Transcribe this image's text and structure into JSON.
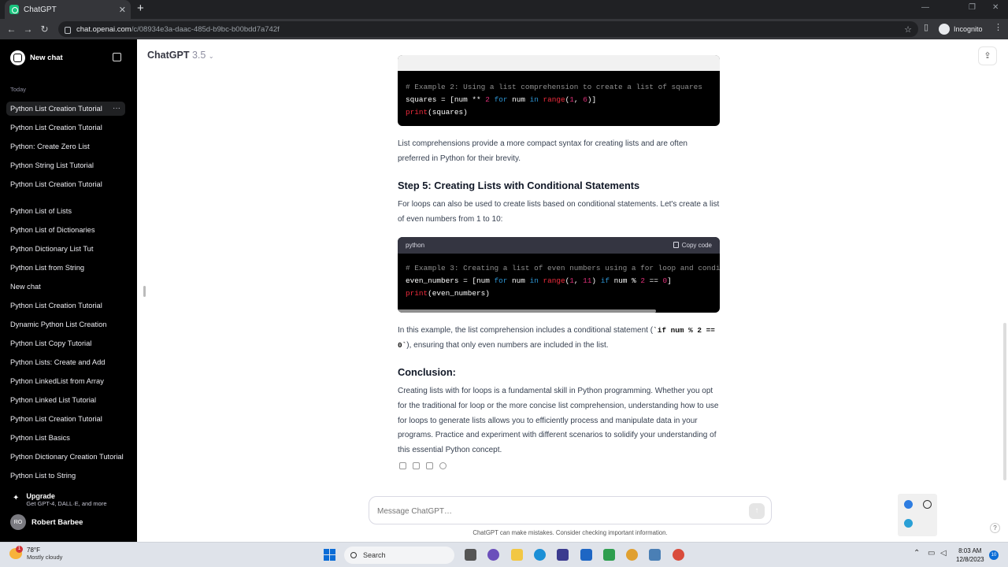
{
  "browser": {
    "tab_title": "ChatGPT",
    "url_host": "chat.openai.com",
    "url_path": "/c/08934e3a-daac-485d-b9bc-b00bdd7a742f",
    "profile_label": "Incognito"
  },
  "sidebar": {
    "new_chat_label": "New chat",
    "section_today": "Today",
    "items": [
      {
        "label": "Python List Creation Tutorial",
        "active": true
      },
      {
        "label": "Python List Creation Tutorial"
      },
      {
        "label": "Python: Create Zero List"
      },
      {
        "label": "Python String List Tutorial"
      },
      {
        "label": "Python List Creation Tutorial"
      },
      {
        "label": "Python List of Lists"
      },
      {
        "label": "Python List of Dictionaries"
      },
      {
        "label": "Python Dictionary List Tut"
      },
      {
        "label": "Python List from String"
      },
      {
        "label": "New chat"
      },
      {
        "label": "Python List Creation Tutorial"
      },
      {
        "label": "Dynamic Python List Creation"
      },
      {
        "label": "Python List Copy Tutorial"
      },
      {
        "label": "Python Lists: Create and Add"
      },
      {
        "label": "Python LinkedList from Array"
      },
      {
        "label": "Python Linked List Tutorial"
      },
      {
        "label": "Python List Creation Tutorial"
      },
      {
        "label": "Python List Basics"
      },
      {
        "label": "Python Dictionary Creation Tutorial"
      },
      {
        "label": "Python List to String"
      }
    ],
    "upgrade_title": "Upgrade",
    "upgrade_subtitle": "Get GPT-4, DALL·E, and more",
    "user_initials": "RO",
    "user_name": "Robert Barbee"
  },
  "main": {
    "model_name": "ChatGPT",
    "model_version": "3.5",
    "code1": {
      "lines": [
        [
          {
            "t": "# Example 2: Using a list comprehension to create a list of squares",
            "c": "cm"
          }
        ],
        [
          {
            "t": "squares = [num ** "
          },
          {
            "t": "2",
            "c": "nm"
          },
          {
            "t": " "
          },
          {
            "t": "for",
            "c": "kw"
          },
          {
            "t": " num "
          },
          {
            "t": "in",
            "c": "kw"
          },
          {
            "t": " "
          },
          {
            "t": "range",
            "c": "fn"
          },
          {
            "t": "("
          },
          {
            "t": "1",
            "c": "nm"
          },
          {
            "t": ", "
          },
          {
            "t": "6",
            "c": "nm"
          },
          {
            "t": ")]"
          }
        ],
        [
          {
            "t": "print",
            "c": "fn"
          },
          {
            "t": "(squares)"
          }
        ]
      ]
    },
    "para1": "List comprehensions provide a more compact syntax for creating lists and are often preferred in Python for their brevity.",
    "step5_heading": "Step 5: Creating Lists with Conditional Statements",
    "para2": "For loops can also be used to create lists based on conditional statements. Let's create a list of even numbers from 1 to 10:",
    "code2": {
      "language": "python",
      "copy_label": "Copy code",
      "lines": [
        [
          {
            "t": "# Example 3: Creating a list of even numbers using a for loop and condi",
            "c": "cm"
          }
        ],
        [
          {
            "t": "even_numbers = [num "
          },
          {
            "t": "for",
            "c": "kw"
          },
          {
            "t": " num "
          },
          {
            "t": "in",
            "c": "kw"
          },
          {
            "t": " "
          },
          {
            "t": "range",
            "c": "fn"
          },
          {
            "t": "("
          },
          {
            "t": "1",
            "c": "nm"
          },
          {
            "t": ", "
          },
          {
            "t": "11",
            "c": "nm"
          },
          {
            "t": ") "
          },
          {
            "t": "if",
            "c": "kw"
          },
          {
            "t": " num % "
          },
          {
            "t": "2",
            "c": "nm"
          },
          {
            "t": " == "
          },
          {
            "t": "0",
            "c": "nm"
          },
          {
            "t": "]"
          }
        ],
        [
          {
            "t": "print",
            "c": "fn"
          },
          {
            "t": "(even_numbers)"
          }
        ]
      ]
    },
    "para3_before": "In this example, the list comprehension includes a conditional statement (",
    "para3_code": "`if num % 2 == 0`",
    "para3_after": "), ensuring that only even numbers are included in the list.",
    "conclusion_heading": "Conclusion:",
    "para4": "Creating lists with for loops is a fundamental skill in Python programming. Whether you opt for the traditional for loop or the more concise list comprehension, understanding how to use for loops to generate lists allows you to efficiently process and manipulate data in your programs. Practice and experiment with different scenarios to solidify your understanding of this essential Python concept.",
    "composer_placeholder": "Message ChatGPT…",
    "disclaimer": "ChatGPT can make mistakes. Consider checking important information."
  },
  "taskbar": {
    "weather_temp": "78°F",
    "weather_desc": "Mostly cloudy",
    "weather_badge": "1",
    "search_label": "Search",
    "time": "8:03 AM",
    "date": "12/8/2023",
    "notif_count": "10"
  }
}
